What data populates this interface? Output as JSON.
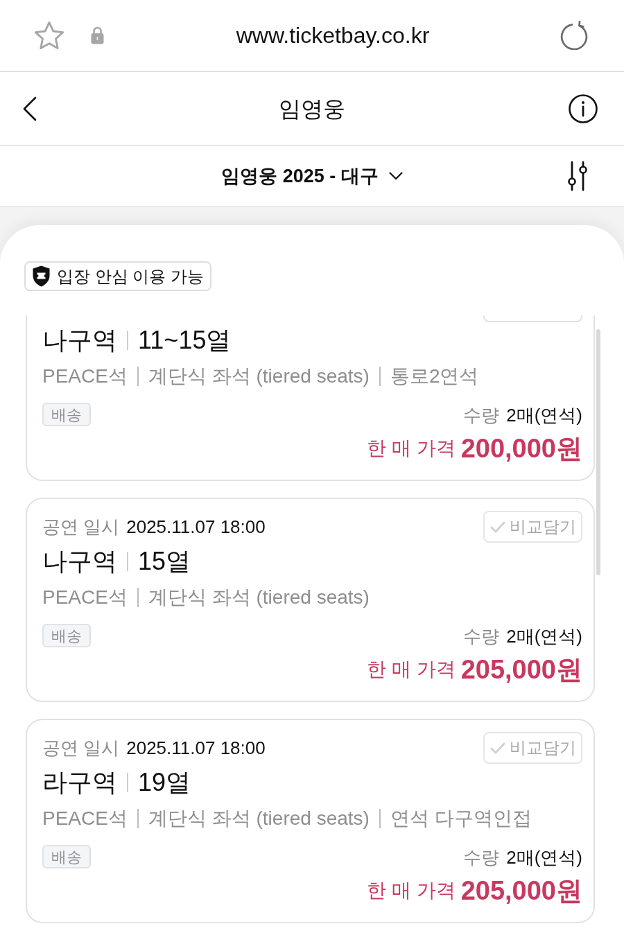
{
  "browser": {
    "url": "www.ticketbay.co.kr"
  },
  "header": {
    "title": "임영웅"
  },
  "filter_bar": {
    "selection": "임영웅 2025 - 대구"
  },
  "badge": {
    "label": "입장 안심 이용 가능"
  },
  "listings": [
    {
      "cut_top": true,
      "section": "나구역",
      "rows": "11~15열",
      "details": [
        "PEACE석",
        "계단식 좌석 (tiered seats)",
        "통로2연석"
      ],
      "delivery": "배송",
      "quantity_label": "수량",
      "quantity": "2매(연석)",
      "price_label": "한 매 가격",
      "price": "200,000원"
    },
    {
      "cut_top": false,
      "date_label": "공연 일시",
      "date": "2025.11.07 18:00",
      "compare": {
        "label": "비교담기",
        "selected": false
      },
      "section": "나구역",
      "rows": "15열",
      "details": [
        "PEACE석",
        "계단식 좌석 (tiered seats)"
      ],
      "delivery": "배송",
      "quantity_label": "수량",
      "quantity": "2매(연석)",
      "price_label": "한 매 가격",
      "price": "205,000원"
    },
    {
      "cut_top": false,
      "date_label": "공연 일시",
      "date": "2025.11.07 18:00",
      "compare": {
        "label": "비교담기",
        "selected": false
      },
      "section": "라구역",
      "rows": "19열",
      "details": [
        "PEACE석",
        "계단식 좌석 (tiered seats)",
        "연석 다구역인접"
      ],
      "delivery": "배송",
      "quantity_label": "수량",
      "quantity": "2매(연석)",
      "price_label": "한 매 가격",
      "price": "205,000원"
    }
  ]
}
